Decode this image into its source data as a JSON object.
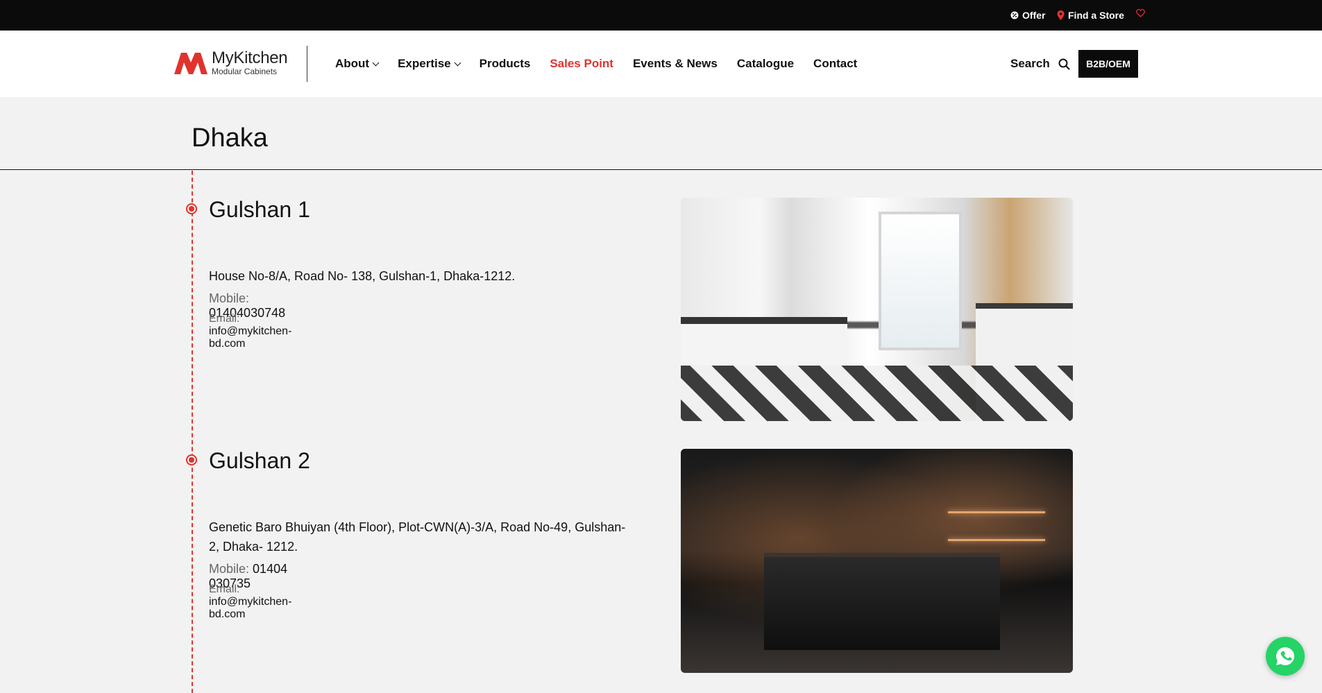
{
  "topbar": {
    "offer_label": "Offer",
    "find_store_label": "Find a Store"
  },
  "header": {
    "logo": {
      "name": "MyKitchen",
      "subtitle": "Modular Cabinets"
    },
    "nav": [
      {
        "label": "About",
        "has_dropdown": true,
        "active": false
      },
      {
        "label": "Expertise",
        "has_dropdown": true,
        "active": false
      },
      {
        "label": "Products",
        "has_dropdown": false,
        "active": false
      },
      {
        "label": "Sales Point",
        "has_dropdown": false,
        "active": true
      },
      {
        "label": "Events & News",
        "has_dropdown": false,
        "active": false
      },
      {
        "label": "Catalogue",
        "has_dropdown": false,
        "active": false
      },
      {
        "label": "Contact",
        "has_dropdown": false,
        "active": false
      }
    ],
    "search_label": "Search",
    "b2b_label": "B2B/OEM"
  },
  "city": {
    "title": "Dhaka"
  },
  "branches": [
    {
      "name": "Gulshan 1",
      "address": "House No-8/A, Road No- 138, Gulshan-1, Dhaka-1212.",
      "mobile_label": "Mobile:",
      "mobile": "01404030748",
      "email_label": "Email:",
      "email": "info@mykitchen-bd.com"
    },
    {
      "name": "Gulshan 2",
      "address": "Genetic Baro Bhuiyan (4th Floor), Plot-CWN(A)-3/A, Road No-49, Gulshan-2, Dhaka- 1212.",
      "mobile_label": "Mobile:",
      "mobile": "01404 030735",
      "email_label": "Email:",
      "email": "info@mykitchen-bd.com"
    }
  ],
  "colors": {
    "accent": "#e0332e",
    "topbar_bg": "#0b0b0b",
    "page_bg": "#f2f2f2",
    "whatsapp": "#25d366"
  },
  "icons": {
    "offer": "badge-percent-icon",
    "store": "map-pin-icon",
    "wishlist": "heart-icon",
    "search": "search-icon",
    "chat": "whatsapp-icon"
  }
}
